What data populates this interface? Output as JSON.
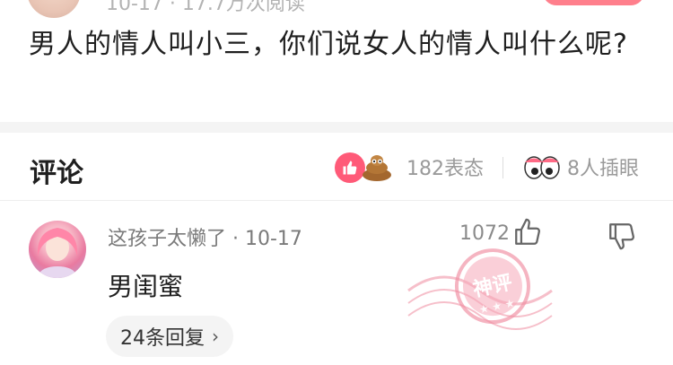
{
  "post": {
    "meta": "10-17 · 17.7万次阅读",
    "text": "男人的情人叫小三，你们说女人的情人叫什么呢?"
  },
  "comments_header": {
    "title": "评论",
    "reaction_count": "182表态",
    "peek_count": "8人插眼"
  },
  "comment": {
    "author_line": "这孩子太懒了 · 10-17",
    "like_count": "1072",
    "text": "男闺蜜",
    "reply_label": "24条回复",
    "stamp_text": "神评"
  },
  "colors": {
    "accent": "#ff5a78",
    "follow": "#ff7f8c",
    "stamp": "#f08ca0",
    "muted_text": "#9a9a9a"
  },
  "icons": [
    "thumbs-up-icon",
    "poop-icon",
    "eyes-icon",
    "like-icon",
    "dislike-icon",
    "chevron-right-icon",
    "stamp-icon"
  ]
}
